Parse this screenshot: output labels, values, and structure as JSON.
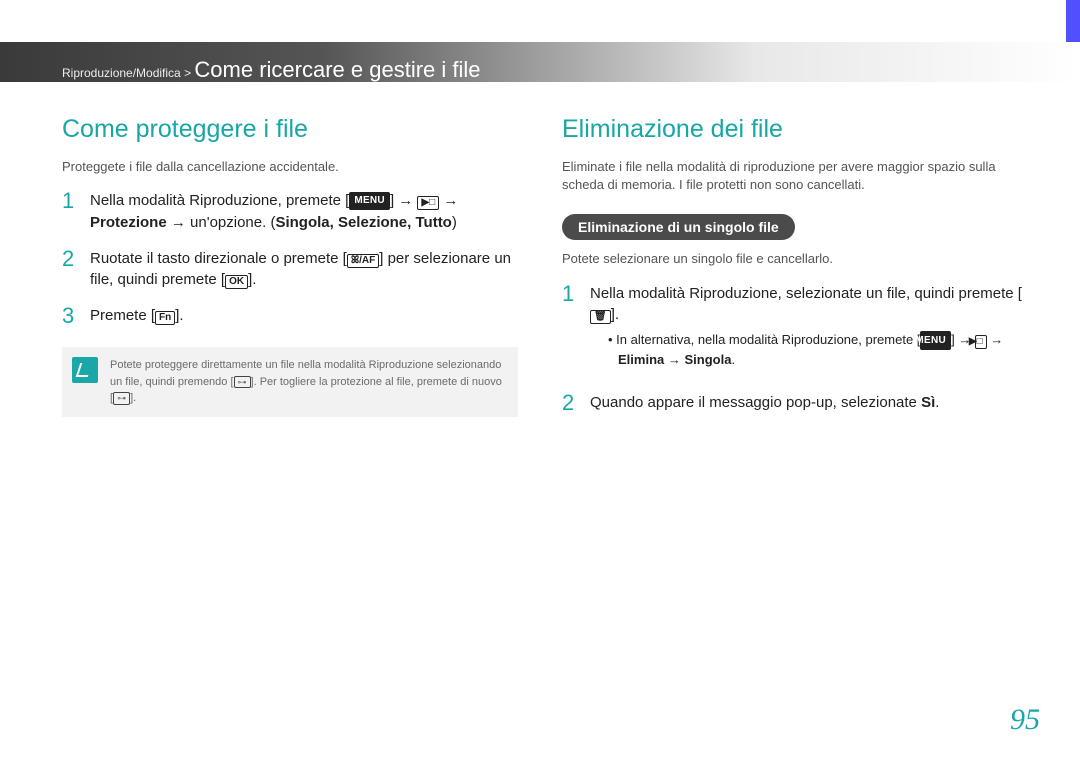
{
  "header": {
    "breadcrumb_small": "Riproduzione/Modifica > ",
    "breadcrumb_large": "Come ricercare e gestire i file"
  },
  "left": {
    "title": "Come proteggere i file",
    "intro": "Proteggete i file dalla cancellazione accidentale.",
    "step1_a": "Nella modalità Riproduzione, premete [",
    "step1_menu": "MENU",
    "step1_b": "] → ",
    "step1_play": "▶□",
    "step1_c": " → ",
    "step1_prot": "Protezione",
    "step1_d": " → un'opzione. (",
    "step1_opts": "Singola, Selezione, Tutto",
    "step1_e": ")",
    "step2_a": "Ruotate il tasto direzionale o premete [",
    "step2_icons": "ꕤ/AF",
    "step2_b": "] per selezionare un file, quindi premete [",
    "step2_ok": "OK",
    "step2_c": "].",
    "step3_a": "Premete [",
    "step3_fn": "Fn",
    "step3_b": "].",
    "note_a": "Potete proteggere direttamente un file nella modalità Riproduzione selezionando un file, quindi premendo [",
    "note_key1": "⊶",
    "note_b": "]. Per togliere la protezione al file, premete di nuovo [",
    "note_key2": "⊶",
    "note_c": "]."
  },
  "right": {
    "title": "Eliminazione dei file",
    "intro": "Eliminate i file nella modalità di riproduzione per avere maggior spazio sulla scheda di memoria. I file protetti non sono cancellati.",
    "pill": "Eliminazione di un singolo file",
    "sub_intro": "Potete selezionare un singolo file e cancellarlo.",
    "step1_a": "Nella modalità Riproduzione, selezionate un file, quindi premete [",
    "step1_trash": "🗑",
    "step1_b": "].",
    "bullet_a": "In alternativa, nella modalità Riproduzione, premete [",
    "bullet_menu": "MENU",
    "bullet_b": "] → ",
    "bullet_play": "▶□",
    "bullet_c": " → ",
    "bullet_elim": "Elimina",
    "bullet_d": " → ",
    "bullet_sing": "Singola",
    "bullet_e": ".",
    "step2_a": "Quando appare il messaggio pop-up, selezionate ",
    "step2_si": "Sì",
    "step2_b": "."
  },
  "page_number": "95"
}
